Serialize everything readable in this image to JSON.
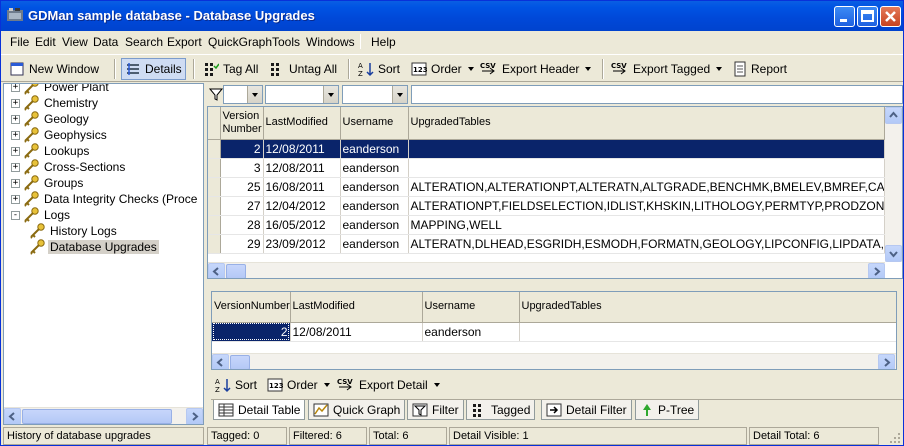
{
  "window": {
    "title": "GDMan sample database - Database Upgrades"
  },
  "menu": [
    "File",
    "Edit",
    "View",
    "Data",
    "Search",
    "Export",
    "QuickGraph",
    "Tools",
    "Windows",
    "Help"
  ],
  "toolbar": {
    "new_window": "New Window",
    "details": "Details",
    "tag_all": "Tag All",
    "untag_all": "Untag All",
    "sort": "Sort",
    "order": "Order",
    "export_header": "Export Header",
    "export_tagged": "Export Tagged",
    "report": "Report"
  },
  "tree": {
    "items": [
      {
        "label": "Power Plant",
        "level": 0,
        "expander": "+"
      },
      {
        "label": "Chemistry",
        "level": 0,
        "expander": "+"
      },
      {
        "label": "Geology",
        "level": 0,
        "expander": "+"
      },
      {
        "label": "Geophysics",
        "level": 0,
        "expander": "+"
      },
      {
        "label": "Lookups",
        "level": 0,
        "expander": "+"
      },
      {
        "label": "Cross-Sections",
        "level": 0,
        "expander": "+"
      },
      {
        "label": "Groups",
        "level": 0,
        "expander": "+"
      },
      {
        "label": "Data Integrity Checks (Proce",
        "level": 0,
        "expander": "+"
      },
      {
        "label": "Logs",
        "level": 0,
        "expander": "-"
      },
      {
        "label": "History Logs",
        "level": 1,
        "expander": ""
      },
      {
        "label": "Database Upgrades",
        "level": 1,
        "expander": ""
      }
    ]
  },
  "grid1": {
    "columns": [
      "Version Number",
      "LastModified",
      "Username",
      "UpgradedTables"
    ],
    "rows": [
      [
        "2",
        "12/08/2011",
        "eanderson",
        ""
      ],
      [
        "3",
        "12/08/2011",
        "eanderson",
        ""
      ],
      [
        "25",
        "16/08/2011",
        "eanderson",
        "ALTERATION,ALTERATIONPT,ALTERATN,ALTGRADE,BENCHMK,BMELEV,BMREF,CASE"
      ],
      [
        "27",
        "12/04/2012",
        "eanderson",
        "ALTERATIONPT,FIELDSELECTION,IDLIST,KHSKIN,LITHOLOGY,PERMTYP,PRODZONE,S"
      ],
      [
        "28",
        "16/05/2012",
        "eanderson",
        "MAPPING,WELL"
      ],
      [
        "29",
        "23/09/2012",
        "eanderson",
        "ALTERATN,DLHEAD,ESGRIDH,ESMODH,FORMATN,GEOLOGY,LIPCONFIG,LIPDATA,LIPI"
      ]
    ]
  },
  "grid2": {
    "columns": [
      "VersionNumber",
      "LastModified",
      "Username",
      "UpgradedTables"
    ],
    "rows": [
      [
        "2",
        "12/08/2011",
        "eanderson",
        ""
      ]
    ]
  },
  "detail_toolbar": {
    "sort": "Sort",
    "order": "Order",
    "export_detail": "Export Detail"
  },
  "tabs": [
    "Detail Table",
    "Quick Graph",
    "Filter",
    "Tagged",
    "Detail Filter",
    "P-Tree"
  ],
  "status": {
    "description": "History of database upgrades",
    "tagged": "Tagged: 0",
    "filtered": "Filtered: 6",
    "total": "Total: 6",
    "detail_visible": "Detail Visible: 1",
    "detail_total": "Detail Total: 6"
  },
  "colors": {
    "titlebar": "#0054e3",
    "selection": "#0a246a",
    "chrome": "#ece9d8"
  }
}
